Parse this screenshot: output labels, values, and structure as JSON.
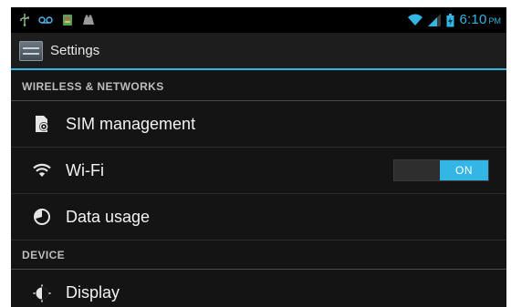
{
  "status_bar": {
    "time": "6:10",
    "ampm": "PM",
    "icons": [
      "usb-icon",
      "voicemail-icon",
      "sim-toolkit-icon",
      "notification-icon",
      "wifi-signal-icon",
      "cell-signal-icon",
      "battery-icon"
    ]
  },
  "action_bar": {
    "title": "Settings",
    "icon": "settings-app-icon"
  },
  "sections": [
    {
      "header": "WIRELESS & NETWORKS",
      "items": [
        {
          "label": "SIM management",
          "icon": "sim-management-icon"
        },
        {
          "label": "Wi-Fi",
          "icon": "wifi-icon",
          "toggle": "ON"
        },
        {
          "label": "Data usage",
          "icon": "data-usage-icon"
        }
      ]
    },
    {
      "header": "DEVICE",
      "items": [
        {
          "label": "Display",
          "icon": "display-icon"
        }
      ]
    }
  ],
  "colors": {
    "accent": "#33b5e5",
    "background": "#141414",
    "action_bar": "#1d1d1d",
    "text": "#f2f2f2"
  }
}
